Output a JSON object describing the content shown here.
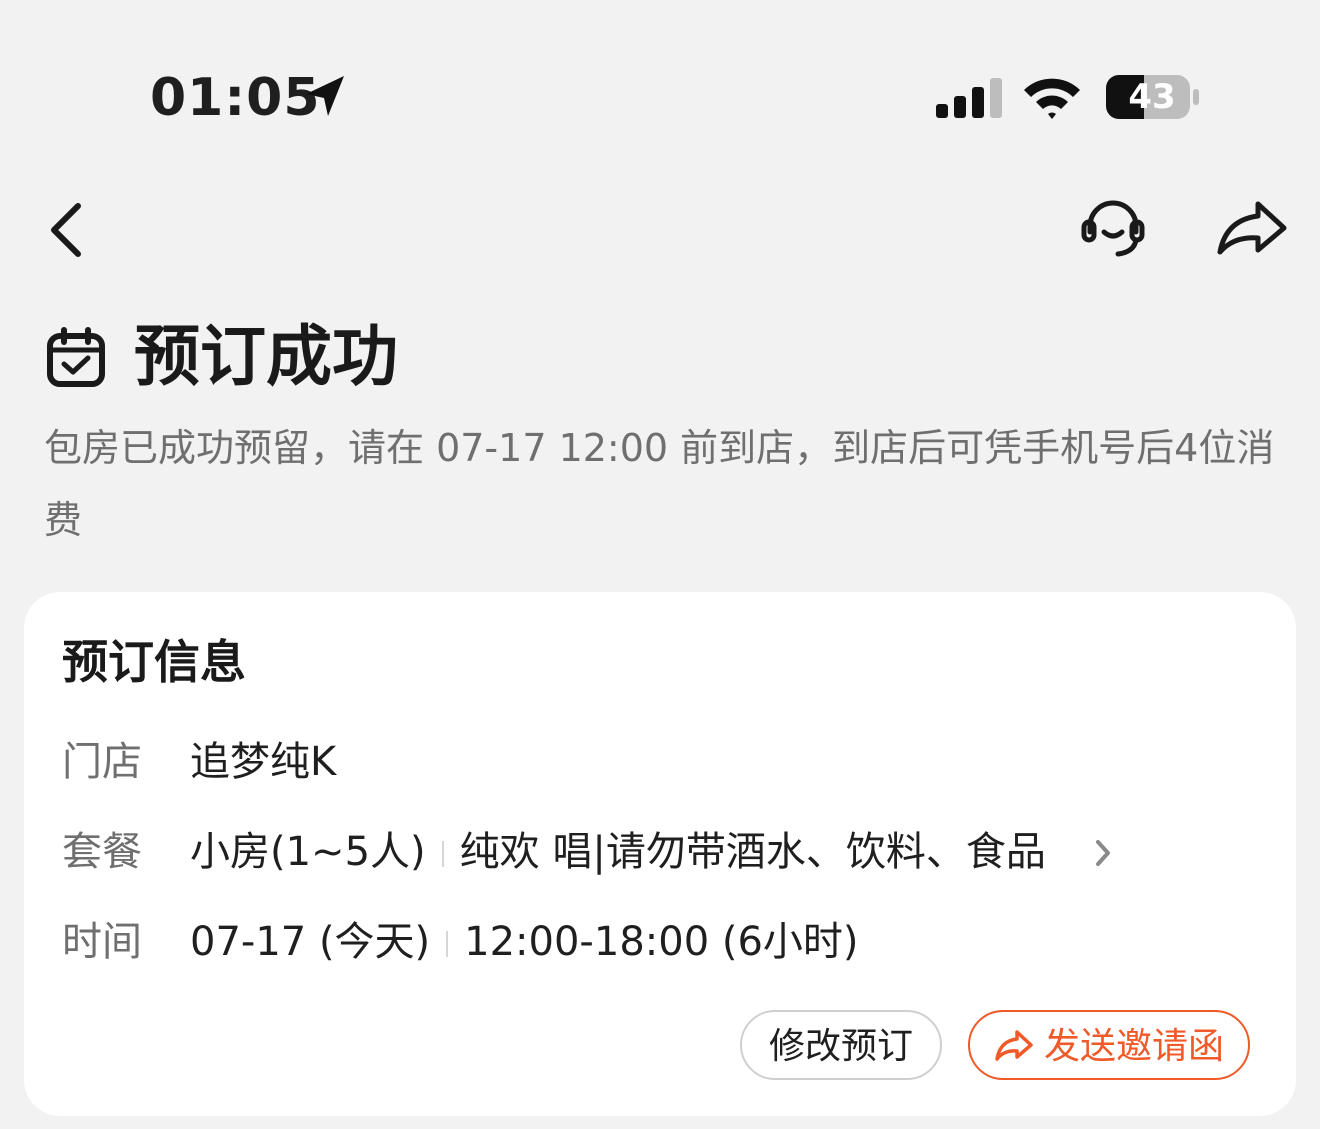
{
  "status_bar": {
    "time": "01:05",
    "battery": "43",
    "icons": [
      "location-arrow-icon",
      "signal-icon",
      "wifi-icon",
      "battery-icon"
    ]
  },
  "nav": {
    "icons": [
      "back-chevron-icon",
      "customer-service-icon",
      "share-icon"
    ]
  },
  "header": {
    "title": "预订成功",
    "subtitle": "包房已成功预留，请在 07-17 12:00 前到店，到店后可凭手机号后4位消费",
    "icon": "calendar-check-icon"
  },
  "card": {
    "title": "预订信息",
    "rows": [
      {
        "label": "门店",
        "value": "追梦纯K"
      },
      {
        "label": "套餐",
        "value_a": "小房(1~5人)",
        "value_b": "纯欢 唱|请勿带酒水、饮料、食品"
      },
      {
        "label": "时间",
        "value_a": "07-17 (今天)",
        "value_b": "12:00-18:00 (6小时)"
      }
    ],
    "buttons": {
      "modify": "修改预订",
      "invite": "发送邀请函"
    }
  },
  "colors": {
    "accent": "#f05a28",
    "background": "#f2f2f2",
    "card": "#ffffff",
    "secondary_text": "#6f6f6f"
  }
}
